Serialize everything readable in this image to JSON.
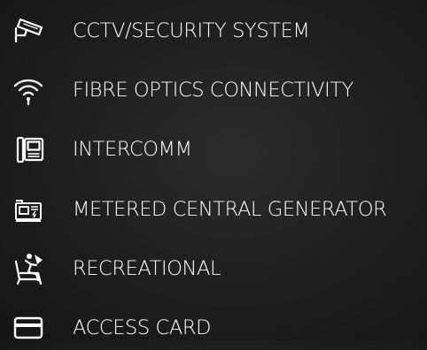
{
  "amenities": [
    {
      "label": "CCTV/SECURITY SYSTEM",
      "icon": "cctv-camera-icon"
    },
    {
      "label": "FIBRE OPTICS CONNECTIVITY",
      "icon": "wifi-icon"
    },
    {
      "label": "INTERCOMM",
      "icon": "intercom-icon"
    },
    {
      "label": "METERED CENTRAL GENERATOR",
      "icon": "generator-icon"
    },
    {
      "label": "RECREATIONAL",
      "icon": "lounge-chair-icon"
    },
    {
      "label": "ACCESS CARD",
      "icon": "access-card-icon"
    }
  ],
  "colors": {
    "text": "#ffffff",
    "background": "#1e1e1e"
  }
}
